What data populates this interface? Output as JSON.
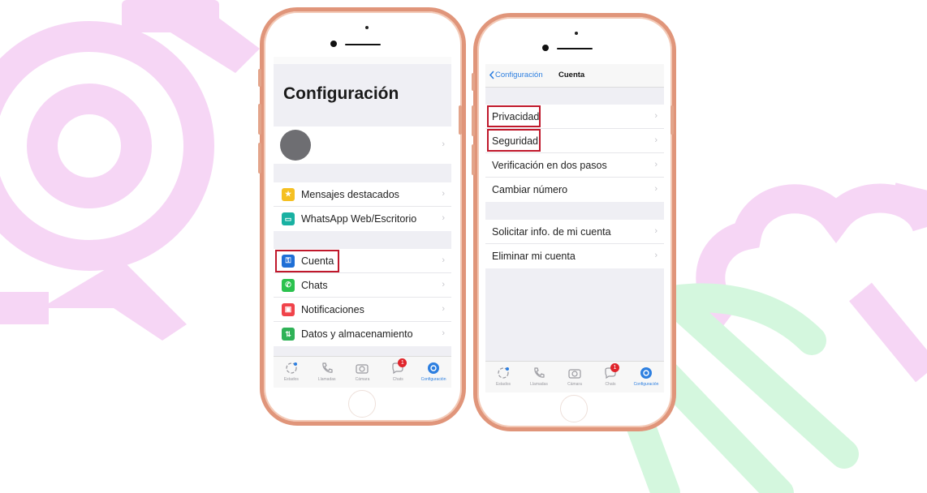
{
  "colors": {
    "frame": "#e0957a",
    "highlight": "#c0182b",
    "ios_blue": "#2d7fe0",
    "decor_pink": "#f6d6f5",
    "decor_green": "#d4f7de"
  },
  "left_screen": {
    "title": "Configuración",
    "profile_chevron": "›",
    "group1": [
      {
        "label": "Mensajes destacados",
        "icon": "star-icon",
        "color": "#f5c022",
        "glyph": "★"
      },
      {
        "label": "WhatsApp Web/Escritorio",
        "icon": "laptop-icon",
        "color": "#19b1a2",
        "glyph": "▭"
      }
    ],
    "group2": [
      {
        "label": "Cuenta",
        "icon": "key-icon",
        "color": "#1f6fd6",
        "glyph": "⚿"
      },
      {
        "label": "Chats",
        "icon": "whatsapp-icon",
        "color": "#2bc24e",
        "glyph": "✆"
      },
      {
        "label": "Notificaciones",
        "icon": "notification-icon",
        "color": "#f0434a",
        "glyph": "▣"
      },
      {
        "label": "Datos y almacenamiento",
        "icon": "data-icon",
        "color": "#2fb257",
        "glyph": "⇅"
      }
    ],
    "chevron": "›"
  },
  "right_screen": {
    "back_label": "Configuración",
    "nav_title": "Cuenta",
    "group1": [
      {
        "label": "Privacidad"
      },
      {
        "label": "Seguridad"
      },
      {
        "label": "Verificación en dos pasos"
      },
      {
        "label": "Cambiar número"
      }
    ],
    "group2": [
      {
        "label": "Solicitar info. de mi cuenta"
      },
      {
        "label": "Eliminar mi cuenta"
      }
    ],
    "chevron": "›"
  },
  "tabbar": {
    "tabs": [
      {
        "label": "Estados",
        "icon": "status-icon"
      },
      {
        "label": "Llamadas",
        "icon": "phone-icon"
      },
      {
        "label": "Cámara",
        "icon": "camera-icon"
      },
      {
        "label": "Chats",
        "icon": "chats-icon",
        "badge": "1"
      },
      {
        "label": "Configuración",
        "icon": "settings-icon",
        "active": true
      }
    ]
  }
}
